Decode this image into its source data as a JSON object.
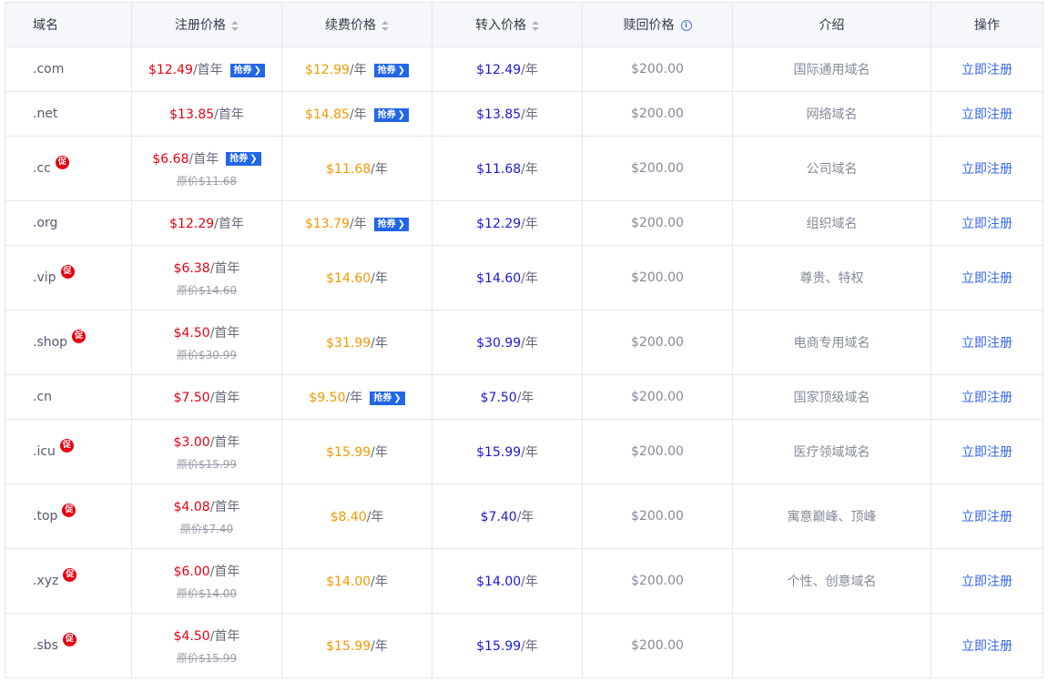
{
  "header": {
    "domain": "域名",
    "register": "注册价格",
    "renew": "续费价格",
    "transfer": "转入价格",
    "redeem": "赎回价格",
    "info_icon": "info-icon",
    "desc": "介绍",
    "action": "操作"
  },
  "labels": {
    "promo_badge": "促",
    "coupon": "抢券",
    "coupon_chevron": "❯",
    "first_year": "/首年",
    "per_year": "/年"
  },
  "rows": [
    {
      "ext": ".com",
      "promo": false,
      "reg_price": "$12.49",
      "reg_coupon": true,
      "orig": "",
      "renew_price": "$12.99",
      "renew_coupon": true,
      "transfer": "$12.49",
      "redeem": "$200.00",
      "desc": "国际通用域名",
      "action": "立即注册"
    },
    {
      "ext": ".net",
      "promo": false,
      "reg_price": "$13.85",
      "reg_coupon": false,
      "orig": "",
      "renew_price": "$14.85",
      "renew_coupon": true,
      "transfer": "$13.85",
      "redeem": "$200.00",
      "desc": "网络域名",
      "action": "立即注册"
    },
    {
      "ext": ".cc",
      "promo": true,
      "reg_price": "$6.68",
      "reg_coupon": true,
      "orig": "原价$11.68",
      "renew_price": "$11.68",
      "renew_coupon": false,
      "transfer": "$11.68",
      "redeem": "$200.00",
      "desc": "公司域名",
      "action": "立即注册"
    },
    {
      "ext": ".org",
      "promo": false,
      "reg_price": "$12.29",
      "reg_coupon": false,
      "orig": "",
      "renew_price": "$13.79",
      "renew_coupon": true,
      "transfer": "$12.29",
      "redeem": "$200.00",
      "desc": "组织域名",
      "action": "立即注册"
    },
    {
      "ext": ".vip",
      "promo": true,
      "reg_price": "$6.38",
      "reg_coupon": false,
      "orig": "原价$14.60",
      "renew_price": "$14.60",
      "renew_coupon": false,
      "transfer": "$14.60",
      "redeem": "$200.00",
      "desc": "尊贵、特权",
      "action": "立即注册"
    },
    {
      "ext": ".shop",
      "promo": true,
      "reg_price": "$4.50",
      "reg_coupon": false,
      "orig": "原价$30.99",
      "renew_price": "$31.99",
      "renew_coupon": false,
      "transfer": "$30.99",
      "redeem": "$200.00",
      "desc": "电商专用域名",
      "action": "立即注册"
    },
    {
      "ext": ".cn",
      "promo": false,
      "reg_price": "$7.50",
      "reg_coupon": false,
      "orig": "",
      "renew_price": "$9.50",
      "renew_coupon": true,
      "transfer": "$7.50",
      "redeem": "$200.00",
      "desc": "国家顶级域名",
      "action": "立即注册"
    },
    {
      "ext": ".icu",
      "promo": true,
      "reg_price": "$3.00",
      "reg_coupon": false,
      "orig": "原价$15.99",
      "renew_price": "$15.99",
      "renew_coupon": false,
      "transfer": "$15.99",
      "redeem": "$200.00",
      "desc": "医疗领域域名",
      "action": "立即注册"
    },
    {
      "ext": ".top",
      "promo": true,
      "reg_price": "$4.08",
      "reg_coupon": false,
      "orig": "原价$7.40",
      "renew_price": "$8.40",
      "renew_coupon": false,
      "transfer": "$7.40",
      "redeem": "$200.00",
      "desc": "寓意巅峰、顶峰",
      "action": "立即注册"
    },
    {
      "ext": ".xyz",
      "promo": true,
      "reg_price": "$6.00",
      "reg_coupon": false,
      "orig": "原价$14.00",
      "renew_price": "$14.00",
      "renew_coupon": false,
      "transfer": "$14.00",
      "redeem": "$200.00",
      "desc": "个性、创意域名",
      "action": "立即注册"
    },
    {
      "ext": ".sbs",
      "promo": true,
      "reg_price": "$4.50",
      "reg_coupon": false,
      "orig": "原价$15.99",
      "renew_price": "$15.99",
      "renew_coupon": false,
      "transfer": "$15.99",
      "redeem": "$200.00",
      "desc": "",
      "action": "立即注册"
    }
  ],
  "colors": {
    "register_price": "#e60012",
    "renew_price": "#f39800",
    "transfer_price": "#1a1ad6",
    "link": "#3466e8",
    "coupon_bg": "#2266e8",
    "header_bg": "#f6f7fb",
    "border": "#e3e6ee"
  }
}
